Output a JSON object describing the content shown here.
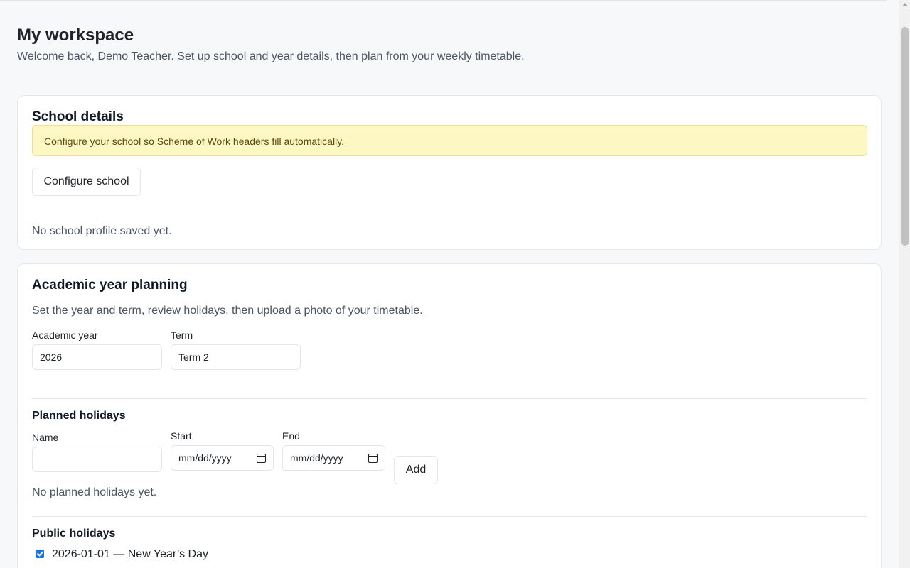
{
  "page": {
    "title": "My workspace",
    "subtitle": "Welcome back, Demo Teacher. Set up school and year details, then plan from your weekly timetable."
  },
  "school": {
    "title": "School details",
    "alert": "Configure your school so Scheme of Work headers fill automatically.",
    "configure_button": "Configure school",
    "empty_text": "No school profile saved yet."
  },
  "year_planning": {
    "title": "Academic year planning",
    "description": "Set the year and term, review holidays, then upload a photo of your timetable.",
    "academic_year_label": "Academic year",
    "academic_year_value": "2026",
    "term_label": "Term",
    "term_value": "Term 2",
    "planned_holidays": {
      "title": "Planned holidays",
      "name_label": "Name",
      "name_value": "",
      "start_label": "Start",
      "start_placeholder": "mm/dd/yyyy",
      "end_label": "End",
      "end_placeholder": "mm/dd/yyyy",
      "add_button": "Add",
      "empty_text": "No planned holidays yet."
    },
    "public_holidays": {
      "title": "Public holidays",
      "items": [
        {
          "label": "2026-01-01 — New Year’s Day",
          "checked": true
        }
      ]
    }
  },
  "colors": {
    "accent": "#1a73e8",
    "alert_bg": "#fdf7c3",
    "page_bg": "#f7f8fa"
  }
}
